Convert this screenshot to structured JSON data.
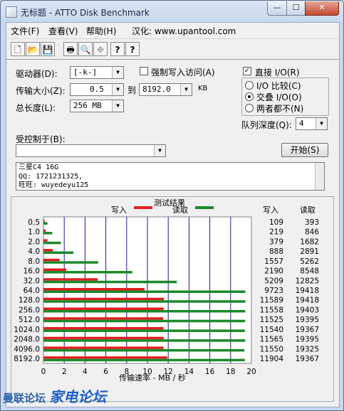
{
  "window": {
    "title": "无标题 - ATTO Disk Benchmark",
    "min": "—",
    "max": "☐",
    "close": "✕"
  },
  "menu": [
    "文件(F)",
    "查看(V)",
    "帮助(H)",
    "汉化: www.upantool.com"
  ],
  "toolbar": {
    "icons": [
      "new-file-icon",
      "open-folder-icon",
      "save-icon",
      "print-icon",
      "print-preview-icon",
      "move-icon",
      "help-icon",
      "context-help-icon"
    ],
    "glyphs": [
      "🗋",
      "📂",
      "💾",
      "🖶",
      "🔍",
      "✥",
      "?",
      "?"
    ]
  },
  "settings": {
    "drive_label": "驱动器(D):",
    "drive_value": "[-k-]",
    "force_write_label": "强制写入访问(A)",
    "transfer_size_label": "传输大小(Z):",
    "transfer_from": "0.5",
    "to_label": "到",
    "transfer_to": "8192.0",
    "kb_label": "KB",
    "total_length_label": "总长度(L):",
    "total_length_value": "256 MB",
    "direct_io_label": "直接 I/O(R)",
    "direct_io_checked": true,
    "io_compare_label": "I/O 比较(C)",
    "overlapped_io_label": "交叠 I/O(O)",
    "neither_label": "两者都不(N)",
    "queue_depth_label": "队列深度(Q):",
    "queue_depth_value": "4",
    "controlled_by_label": "受控制于(B):",
    "controlled_by_value": "",
    "start_button": "开始(S)"
  },
  "notes": [
    "三星C4 16G",
    "QQ: 1721231325,",
    "旺旺: wuyedeyu125"
  ],
  "results": {
    "title": "测试结果",
    "legend_write": "写入",
    "legend_read": "读取",
    "col_write": "写入",
    "col_read": "读取",
    "write_color": "#e02020",
    "read_color": "#1a8a2a"
  },
  "chart_data": {
    "type": "bar",
    "orientation": "horizontal",
    "categories": [
      "0.5",
      "1.0",
      "2.0",
      "4.0",
      "8.0",
      "16.0",
      "32.0",
      "64.0",
      "128.0",
      "256.0",
      "512.0",
      "1024.0",
      "2048.0",
      "4096.0",
      "8192.0"
    ],
    "series": [
      {
        "name": "写入",
        "values": [
          109,
          219,
          379,
          888,
          1557,
          2190,
          5209,
          9723,
          11589,
          11558,
          11525,
          11540,
          11565,
          11550,
          11904
        ]
      },
      {
        "name": "读取",
        "values": [
          393,
          846,
          1682,
          2891,
          5262,
          8548,
          12825,
          19418,
          19418,
          19403,
          19395,
          19367,
          19395,
          19325,
          19367
        ]
      }
    ],
    "xlabel": "传输速率 - MB / 秒",
    "xlim": [
      0,
      20
    ],
    "xticks": [
      0,
      2,
      4,
      6,
      8,
      10,
      12,
      14,
      16,
      18,
      20
    ],
    "grid": true,
    "legend": "top"
  },
  "watermark": {
    "left": "曼联论坛",
    "brand": "家电论坛"
  }
}
